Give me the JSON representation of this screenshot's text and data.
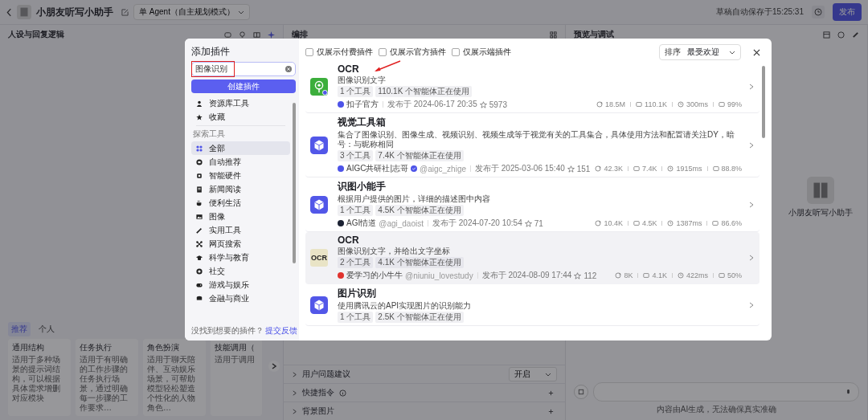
{
  "topbar": {
    "title": "小朋友听写小助手",
    "mode": "单 Agent（自主规划模式）",
    "autosave": "草稿自动保存于15:25:31",
    "publish": "发布"
  },
  "columns": [
    {
      "title": "人设与回复逻辑"
    },
    {
      "title": "编排"
    },
    {
      "title": "预览与调试"
    }
  ],
  "prompt_templates": {
    "tabs": [
      {
        "label": "推荐",
        "selected": true
      },
      {
        "label": "个人",
        "selected": false
      }
    ],
    "cards": [
      {
        "title": "通用结构",
        "desc": "适用于多种场景的提示词结构，可以根据具体需求增删对应模块"
      },
      {
        "title": "任务执行",
        "desc": "适用于有明确的工作步骤的任务执行场景，通过明确每一步骤的工作要求…"
      },
      {
        "title": "角色扮演",
        "desc": "适用于聊天陪伴、互动娱乐场景，可帮助模型轻松塑造个性化的人物角色…"
      },
      {
        "title": "技能调用（",
        "desc": "适用于调用"
      }
    ]
  },
  "orchestration_rows": [
    {
      "label": "用户问题建议",
      "kind": "select",
      "value": "开启"
    },
    {
      "label": "快捷指令",
      "kind": "info"
    },
    {
      "label": "背景图片",
      "kind": "add"
    }
  ],
  "preview": {
    "bot_name": "小朋友听写小助手",
    "disclaimer": "内容由AI生成，无法确保真实准确"
  },
  "dialog": {
    "title": "添加插件",
    "search": {
      "value": "图像识别"
    },
    "create_button": "创建插件",
    "nav": [
      {
        "label": "资源库工具",
        "selected": false
      },
      {
        "label": "收藏",
        "selected": false
      }
    ],
    "section": "探索工具",
    "categories": [
      {
        "label": "全部",
        "selected": true
      },
      {
        "label": "自动推荐",
        "selected": false
      },
      {
        "label": "智能硬件",
        "selected": false
      },
      {
        "label": "新闻阅读",
        "selected": false
      },
      {
        "label": "便利生活",
        "selected": false
      },
      {
        "label": "图像",
        "selected": false
      },
      {
        "label": "实用工具",
        "selected": false
      },
      {
        "label": "网页搜索",
        "selected": false
      },
      {
        "label": "科学与教育",
        "selected": false
      },
      {
        "label": "社交",
        "selected": false
      },
      {
        "label": "游戏与娱乐",
        "selected": false
      },
      {
        "label": "金融与商业",
        "selected": false
      }
    ],
    "footer": {
      "text": "没找到想要的插件？",
      "link": "提交反馈"
    },
    "filters": [
      {
        "label": "仅展示付费插件",
        "checked": false
      },
      {
        "label": "仅展示官方插件",
        "checked": false
      },
      {
        "label": "仅展示端插件",
        "checked": false
      }
    ],
    "sort": {
      "label": "排序",
      "value": "最受欢迎"
    },
    "plugins": [
      {
        "name": "OCR",
        "desc": "图像识别文字",
        "kind": "pin",
        "tags": [
          "1 个工具",
          "110.1K 个智能体正在使用"
        ],
        "author": "扣子官方",
        "color": "#4d53e8",
        "verified": false,
        "published": "发布于 2024-06-17 20:35",
        "stars": "5973",
        "stats": [
          "18.5M",
          "110.1K",
          "300ms",
          "99%"
        ],
        "highlighted": false
      },
      {
        "name": "视觉工具箱",
        "desc": "集合了图像识别、图像生成、视频识别、视频生成等于视觉有关的工具集合，具体使用方法和配置请关注DY，暗号：与昵称相同",
        "kind": "cube",
        "tags": [
          "3 个工具",
          "7.4K 个智能体正在使用"
        ],
        "author": "AIGC共研社|志哥",
        "color": "#4d53e8",
        "verified": true,
        "handle": "@aigc_zhige",
        "published": "发布于 2025-03-06 15:40",
        "stars": "151",
        "stats": [
          "42.3K",
          "7.4K",
          "1915ms",
          "88.8%"
        ],
        "highlighted": false
      },
      {
        "name": "识图小能手",
        "desc": "根据用户提供的图片，详细的描述图中内容",
        "kind": "cube",
        "tags": [
          "1 个工具",
          "4.5K 个智能体正在使用"
        ],
        "author": "AGI情道",
        "color": "#1c2233",
        "verified": false,
        "handle": "@agi_daoist",
        "published": "发布于 2024-07-20 10:54",
        "stars": "71",
        "stats": [
          "10.4K",
          "4.5K",
          "1387ms",
          "86.6%"
        ],
        "highlighted": false
      },
      {
        "name": "OCR",
        "desc": "图像识别文字，并给出文字坐标",
        "kind": "logo",
        "logo_text": "OCR",
        "tags": [
          "2 个工具",
          "4.1K 个智能体正在使用"
        ],
        "author": "爱学习的小牛牛",
        "color": "#e0332e",
        "verified": false,
        "handle": "@niuniu_lovestudy",
        "published": "发布于 2024-08-09 17:44",
        "stars": "112",
        "stats": [
          "8K",
          "4.1K",
          "422ms",
          "50%"
        ],
        "highlighted": true
      },
      {
        "name": "图片识别",
        "desc": "使用腾讯云的API实现图片的识别能力",
        "kind": "cube",
        "tags": [
          "1 个工具",
          "2.5K 个智能体正在使用"
        ],
        "highlighted": false
      }
    ]
  }
}
